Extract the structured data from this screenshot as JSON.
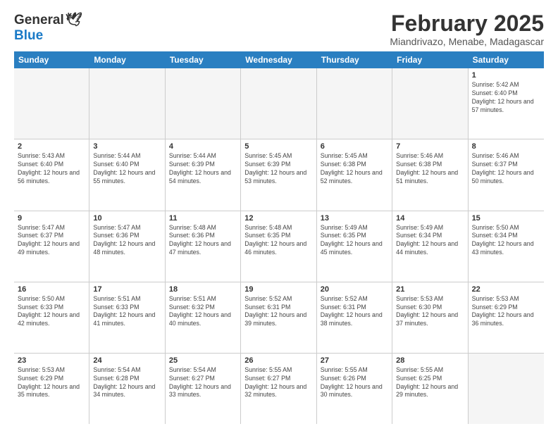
{
  "header": {
    "logo_general": "General",
    "logo_blue": "Blue",
    "month_title": "February 2025",
    "location": "Miandrivazo, Menabe, Madagascar"
  },
  "weekdays": [
    "Sunday",
    "Monday",
    "Tuesday",
    "Wednesday",
    "Thursday",
    "Friday",
    "Saturday"
  ],
  "rows": [
    [
      {
        "day": "",
        "empty": true
      },
      {
        "day": "",
        "empty": true
      },
      {
        "day": "",
        "empty": true
      },
      {
        "day": "",
        "empty": true
      },
      {
        "day": "",
        "empty": true
      },
      {
        "day": "",
        "empty": true
      },
      {
        "day": "1",
        "sunrise": "Sunrise: 5:42 AM",
        "sunset": "Sunset: 6:40 PM",
        "daylight": "Daylight: 12 hours and 57 minutes."
      }
    ],
    [
      {
        "day": "2",
        "sunrise": "Sunrise: 5:43 AM",
        "sunset": "Sunset: 6:40 PM",
        "daylight": "Daylight: 12 hours and 56 minutes."
      },
      {
        "day": "3",
        "sunrise": "Sunrise: 5:44 AM",
        "sunset": "Sunset: 6:40 PM",
        "daylight": "Daylight: 12 hours and 55 minutes."
      },
      {
        "day": "4",
        "sunrise": "Sunrise: 5:44 AM",
        "sunset": "Sunset: 6:39 PM",
        "daylight": "Daylight: 12 hours and 54 minutes."
      },
      {
        "day": "5",
        "sunrise": "Sunrise: 5:45 AM",
        "sunset": "Sunset: 6:39 PM",
        "daylight": "Daylight: 12 hours and 53 minutes."
      },
      {
        "day": "6",
        "sunrise": "Sunrise: 5:45 AM",
        "sunset": "Sunset: 6:38 PM",
        "daylight": "Daylight: 12 hours and 52 minutes."
      },
      {
        "day": "7",
        "sunrise": "Sunrise: 5:46 AM",
        "sunset": "Sunset: 6:38 PM",
        "daylight": "Daylight: 12 hours and 51 minutes."
      },
      {
        "day": "8",
        "sunrise": "Sunrise: 5:46 AM",
        "sunset": "Sunset: 6:37 PM",
        "daylight": "Daylight: 12 hours and 50 minutes."
      }
    ],
    [
      {
        "day": "9",
        "sunrise": "Sunrise: 5:47 AM",
        "sunset": "Sunset: 6:37 PM",
        "daylight": "Daylight: 12 hours and 49 minutes."
      },
      {
        "day": "10",
        "sunrise": "Sunrise: 5:47 AM",
        "sunset": "Sunset: 6:36 PM",
        "daylight": "Daylight: 12 hours and 48 minutes."
      },
      {
        "day": "11",
        "sunrise": "Sunrise: 5:48 AM",
        "sunset": "Sunset: 6:36 PM",
        "daylight": "Daylight: 12 hours and 47 minutes."
      },
      {
        "day": "12",
        "sunrise": "Sunrise: 5:48 AM",
        "sunset": "Sunset: 6:35 PM",
        "daylight": "Daylight: 12 hours and 46 minutes."
      },
      {
        "day": "13",
        "sunrise": "Sunrise: 5:49 AM",
        "sunset": "Sunset: 6:35 PM",
        "daylight": "Daylight: 12 hours and 45 minutes."
      },
      {
        "day": "14",
        "sunrise": "Sunrise: 5:49 AM",
        "sunset": "Sunset: 6:34 PM",
        "daylight": "Daylight: 12 hours and 44 minutes."
      },
      {
        "day": "15",
        "sunrise": "Sunrise: 5:50 AM",
        "sunset": "Sunset: 6:34 PM",
        "daylight": "Daylight: 12 hours and 43 minutes."
      }
    ],
    [
      {
        "day": "16",
        "sunrise": "Sunrise: 5:50 AM",
        "sunset": "Sunset: 6:33 PM",
        "daylight": "Daylight: 12 hours and 42 minutes."
      },
      {
        "day": "17",
        "sunrise": "Sunrise: 5:51 AM",
        "sunset": "Sunset: 6:33 PM",
        "daylight": "Daylight: 12 hours and 41 minutes."
      },
      {
        "day": "18",
        "sunrise": "Sunrise: 5:51 AM",
        "sunset": "Sunset: 6:32 PM",
        "daylight": "Daylight: 12 hours and 40 minutes."
      },
      {
        "day": "19",
        "sunrise": "Sunrise: 5:52 AM",
        "sunset": "Sunset: 6:31 PM",
        "daylight": "Daylight: 12 hours and 39 minutes."
      },
      {
        "day": "20",
        "sunrise": "Sunrise: 5:52 AM",
        "sunset": "Sunset: 6:31 PM",
        "daylight": "Daylight: 12 hours and 38 minutes."
      },
      {
        "day": "21",
        "sunrise": "Sunrise: 5:53 AM",
        "sunset": "Sunset: 6:30 PM",
        "daylight": "Daylight: 12 hours and 37 minutes."
      },
      {
        "day": "22",
        "sunrise": "Sunrise: 5:53 AM",
        "sunset": "Sunset: 6:29 PM",
        "daylight": "Daylight: 12 hours and 36 minutes."
      }
    ],
    [
      {
        "day": "23",
        "sunrise": "Sunrise: 5:53 AM",
        "sunset": "Sunset: 6:29 PM",
        "daylight": "Daylight: 12 hours and 35 minutes."
      },
      {
        "day": "24",
        "sunrise": "Sunrise: 5:54 AM",
        "sunset": "Sunset: 6:28 PM",
        "daylight": "Daylight: 12 hours and 34 minutes."
      },
      {
        "day": "25",
        "sunrise": "Sunrise: 5:54 AM",
        "sunset": "Sunset: 6:27 PM",
        "daylight": "Daylight: 12 hours and 33 minutes."
      },
      {
        "day": "26",
        "sunrise": "Sunrise: 5:55 AM",
        "sunset": "Sunset: 6:27 PM",
        "daylight": "Daylight: 12 hours and 32 minutes."
      },
      {
        "day": "27",
        "sunrise": "Sunrise: 5:55 AM",
        "sunset": "Sunset: 6:26 PM",
        "daylight": "Daylight: 12 hours and 30 minutes."
      },
      {
        "day": "28",
        "sunrise": "Sunrise: 5:55 AM",
        "sunset": "Sunset: 6:25 PM",
        "daylight": "Daylight: 12 hours and 29 minutes."
      },
      {
        "day": "",
        "empty": true
      }
    ]
  ]
}
